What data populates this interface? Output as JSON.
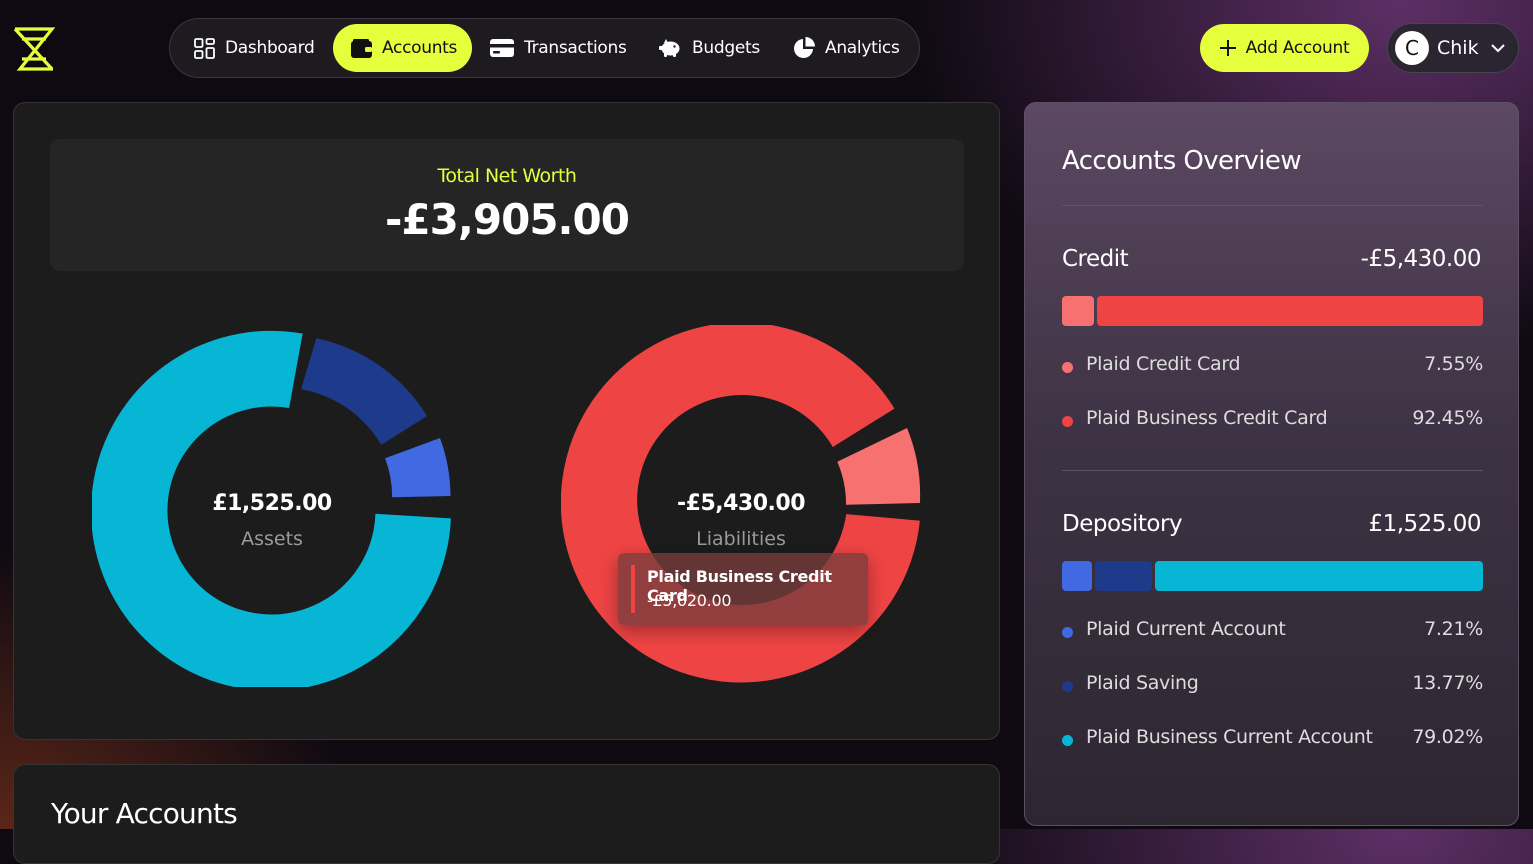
{
  "nav": {
    "items": [
      {
        "label": "Dashboard",
        "icon": "grid-icon"
      },
      {
        "label": "Accounts",
        "icon": "wallet-icon",
        "active": true
      },
      {
        "label": "Transactions",
        "icon": "card-icon"
      },
      {
        "label": "Budgets",
        "icon": "piggy-bank-icon"
      },
      {
        "label": "Analytics",
        "icon": "pie-chart-icon"
      }
    ]
  },
  "header": {
    "add_account_label": "Add Account",
    "user_initial": "C",
    "user_name": "Chik"
  },
  "net_worth": {
    "label": "Total Net Worth",
    "value": "-£3,905.00"
  },
  "assets_chart": {
    "center_value": "£1,525.00",
    "center_label": "Assets"
  },
  "liabilities_chart": {
    "center_value": "-£5,430.00",
    "center_label": "Liabilities"
  },
  "tooltip": {
    "title": "Plaid Business Credit Card",
    "value": "-£5,020.00"
  },
  "your_accounts": {
    "title": "Your Accounts"
  },
  "overview": {
    "title": "Accounts Overview",
    "credit": {
      "title": "Credit",
      "amount": "-£5,430.00",
      "items": [
        {
          "name": "Plaid Credit Card",
          "pct": "7.55%",
          "share": 7.55,
          "color": "#f87171"
        },
        {
          "name": "Plaid Business Credit Card",
          "pct": "92.45%",
          "share": 92.45,
          "color": "#ef4444"
        }
      ]
    },
    "depository": {
      "title": "Depository",
      "amount": "£1,525.00",
      "items": [
        {
          "name": "Plaid Current Account",
          "pct": "7.21%",
          "share": 7.21,
          "color": "#4169e1"
        },
        {
          "name": "Plaid Saving",
          "pct": "13.77%",
          "share": 13.77,
          "color": "#1e3a8a"
        },
        {
          "name": "Plaid Business Current Account",
          "pct": "79.02%",
          "share": 79.02,
          "color": "#06b6d4"
        }
      ]
    }
  },
  "colors": {
    "accent": "#e5ff3c",
    "credit_card": "#f87171",
    "business_credit": "#ef4444",
    "current": "#4169e1",
    "saving": "#1e3a8a",
    "business_current": "#06b6d4"
  }
}
